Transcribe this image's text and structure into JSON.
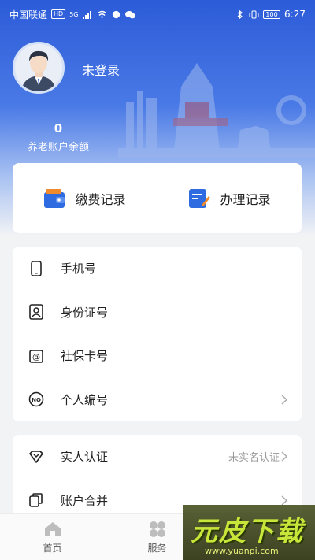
{
  "status_bar": {
    "carrier": "中国联通",
    "hd_badge": "HD",
    "network": "5G",
    "battery": "100",
    "time": "6:27"
  },
  "profile": {
    "login_status": "未登录",
    "balance_value": "0",
    "balance_label": "养老账户余额"
  },
  "records": {
    "payment": "缴费记录",
    "handling": "办理记录"
  },
  "info": {
    "phone": "手机号",
    "id_number": "身份证号",
    "social_card": "社保卡号",
    "personal_no": "个人编号"
  },
  "account": {
    "real_name": "实人认证",
    "real_name_status": "未实名认证",
    "merge": "账户合并"
  },
  "nav": {
    "home": "首页",
    "service": "服务"
  },
  "watermark": {
    "title": "元皮下载",
    "url": "www.yuanpi.com"
  },
  "colors": {
    "brand_blue": "#2c5bd8",
    "accent_orange": "#f08a2a"
  }
}
